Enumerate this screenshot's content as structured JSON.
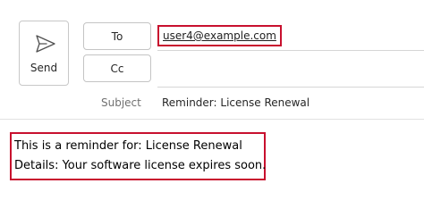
{
  "send": {
    "label": "Send",
    "icon": "send-icon"
  },
  "fields": {
    "to_label": "To",
    "cc_label": "Cc",
    "to_recipient": "user4@example.com",
    "subject_label": "Subject",
    "subject_value": "Reminder: License Renewal"
  },
  "body": {
    "lines": [
      "This is a reminder for: License Renewal",
      "Details: Your software license expires soon."
    ]
  },
  "colors": {
    "highlight_border": "#c8102e",
    "button_border": "#c4c4c4"
  }
}
